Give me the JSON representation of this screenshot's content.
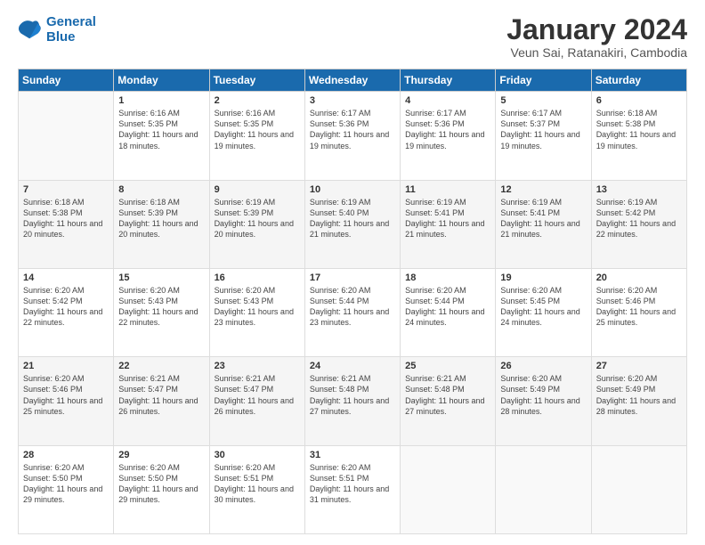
{
  "logo": {
    "line1": "General",
    "line2": "Blue"
  },
  "title": "January 2024",
  "subtitle": "Veun Sai, Ratanakiri, Cambodia",
  "days": [
    "Sunday",
    "Monday",
    "Tuesday",
    "Wednesday",
    "Thursday",
    "Friday",
    "Saturday"
  ],
  "weeks": [
    [
      {
        "day": "",
        "content": ""
      },
      {
        "day": "1",
        "content": "Sunrise: 6:16 AM\nSunset: 5:35 PM\nDaylight: 11 hours and 18 minutes."
      },
      {
        "day": "2",
        "content": "Sunrise: 6:16 AM\nSunset: 5:35 PM\nDaylight: 11 hours and 19 minutes."
      },
      {
        "day": "3",
        "content": "Sunrise: 6:17 AM\nSunset: 5:36 PM\nDaylight: 11 hours and 19 minutes."
      },
      {
        "day": "4",
        "content": "Sunrise: 6:17 AM\nSunset: 5:36 PM\nDaylight: 11 hours and 19 minutes."
      },
      {
        "day": "5",
        "content": "Sunrise: 6:17 AM\nSunset: 5:37 PM\nDaylight: 11 hours and 19 minutes."
      },
      {
        "day": "6",
        "content": "Sunrise: 6:18 AM\nSunset: 5:38 PM\nDaylight: 11 hours and 19 minutes."
      }
    ],
    [
      {
        "day": "7",
        "content": "Sunrise: 6:18 AM\nSunset: 5:38 PM\nDaylight: 11 hours and 20 minutes."
      },
      {
        "day": "8",
        "content": "Sunrise: 6:18 AM\nSunset: 5:39 PM\nDaylight: 11 hours and 20 minutes."
      },
      {
        "day": "9",
        "content": "Sunrise: 6:19 AM\nSunset: 5:39 PM\nDaylight: 11 hours and 20 minutes."
      },
      {
        "day": "10",
        "content": "Sunrise: 6:19 AM\nSunset: 5:40 PM\nDaylight: 11 hours and 21 minutes."
      },
      {
        "day": "11",
        "content": "Sunrise: 6:19 AM\nSunset: 5:41 PM\nDaylight: 11 hours and 21 minutes."
      },
      {
        "day": "12",
        "content": "Sunrise: 6:19 AM\nSunset: 5:41 PM\nDaylight: 11 hours and 21 minutes."
      },
      {
        "day": "13",
        "content": "Sunrise: 6:19 AM\nSunset: 5:42 PM\nDaylight: 11 hours and 22 minutes."
      }
    ],
    [
      {
        "day": "14",
        "content": "Sunrise: 6:20 AM\nSunset: 5:42 PM\nDaylight: 11 hours and 22 minutes."
      },
      {
        "day": "15",
        "content": "Sunrise: 6:20 AM\nSunset: 5:43 PM\nDaylight: 11 hours and 22 minutes."
      },
      {
        "day": "16",
        "content": "Sunrise: 6:20 AM\nSunset: 5:43 PM\nDaylight: 11 hours and 23 minutes."
      },
      {
        "day": "17",
        "content": "Sunrise: 6:20 AM\nSunset: 5:44 PM\nDaylight: 11 hours and 23 minutes."
      },
      {
        "day": "18",
        "content": "Sunrise: 6:20 AM\nSunset: 5:44 PM\nDaylight: 11 hours and 24 minutes."
      },
      {
        "day": "19",
        "content": "Sunrise: 6:20 AM\nSunset: 5:45 PM\nDaylight: 11 hours and 24 minutes."
      },
      {
        "day": "20",
        "content": "Sunrise: 6:20 AM\nSunset: 5:46 PM\nDaylight: 11 hours and 25 minutes."
      }
    ],
    [
      {
        "day": "21",
        "content": "Sunrise: 6:20 AM\nSunset: 5:46 PM\nDaylight: 11 hours and 25 minutes."
      },
      {
        "day": "22",
        "content": "Sunrise: 6:21 AM\nSunset: 5:47 PM\nDaylight: 11 hours and 26 minutes."
      },
      {
        "day": "23",
        "content": "Sunrise: 6:21 AM\nSunset: 5:47 PM\nDaylight: 11 hours and 26 minutes."
      },
      {
        "day": "24",
        "content": "Sunrise: 6:21 AM\nSunset: 5:48 PM\nDaylight: 11 hours and 27 minutes."
      },
      {
        "day": "25",
        "content": "Sunrise: 6:21 AM\nSunset: 5:48 PM\nDaylight: 11 hours and 27 minutes."
      },
      {
        "day": "26",
        "content": "Sunrise: 6:20 AM\nSunset: 5:49 PM\nDaylight: 11 hours and 28 minutes."
      },
      {
        "day": "27",
        "content": "Sunrise: 6:20 AM\nSunset: 5:49 PM\nDaylight: 11 hours and 28 minutes."
      }
    ],
    [
      {
        "day": "28",
        "content": "Sunrise: 6:20 AM\nSunset: 5:50 PM\nDaylight: 11 hours and 29 minutes."
      },
      {
        "day": "29",
        "content": "Sunrise: 6:20 AM\nSunset: 5:50 PM\nDaylight: 11 hours and 29 minutes."
      },
      {
        "day": "30",
        "content": "Sunrise: 6:20 AM\nSunset: 5:51 PM\nDaylight: 11 hours and 30 minutes."
      },
      {
        "day": "31",
        "content": "Sunrise: 6:20 AM\nSunset: 5:51 PM\nDaylight: 11 hours and 31 minutes."
      },
      {
        "day": "",
        "content": ""
      },
      {
        "day": "",
        "content": ""
      },
      {
        "day": "",
        "content": ""
      }
    ]
  ]
}
